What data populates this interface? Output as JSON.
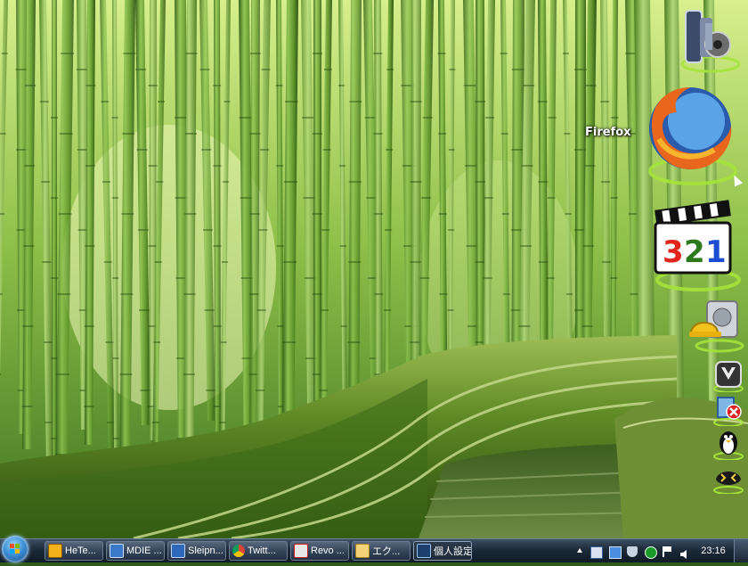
{
  "desktop": {
    "wallpaper": "bamboo-forest",
    "dock_label": "Firefox",
    "dock_icons": [
      "sound-icon",
      "firefox-icon",
      "media-player-classic-icon",
      "disk-utility-icon",
      "archiver-icon",
      "remove-program-icon",
      "penguin-icon",
      "sleipnir-icon"
    ]
  },
  "taskbar": {
    "tasks": [
      {
        "label": "HeTe...",
        "icon": "hete-icon"
      },
      {
        "label": "MDIE ...",
        "icon": "mdie-icon"
      },
      {
        "label": "Sleipn...",
        "icon": "sleipnir-icon"
      },
      {
        "label": "Twitt...",
        "icon": "chrome-icon"
      },
      {
        "label": "Revo ...",
        "icon": "revo-icon"
      },
      {
        "label": "エク...",
        "icon": "folder-icon"
      },
      {
        "label": "個人設定",
        "icon": "personalize-icon"
      }
    ],
    "tray_icons": [
      "mail-icon",
      "network-icon",
      "shield-icon",
      "block-icon",
      "flag-icon",
      "volume-icon"
    ],
    "clock": "23:16"
  },
  "colors": {
    "bamboo": "#6fa23a",
    "taskbar": "#1c2a39"
  }
}
